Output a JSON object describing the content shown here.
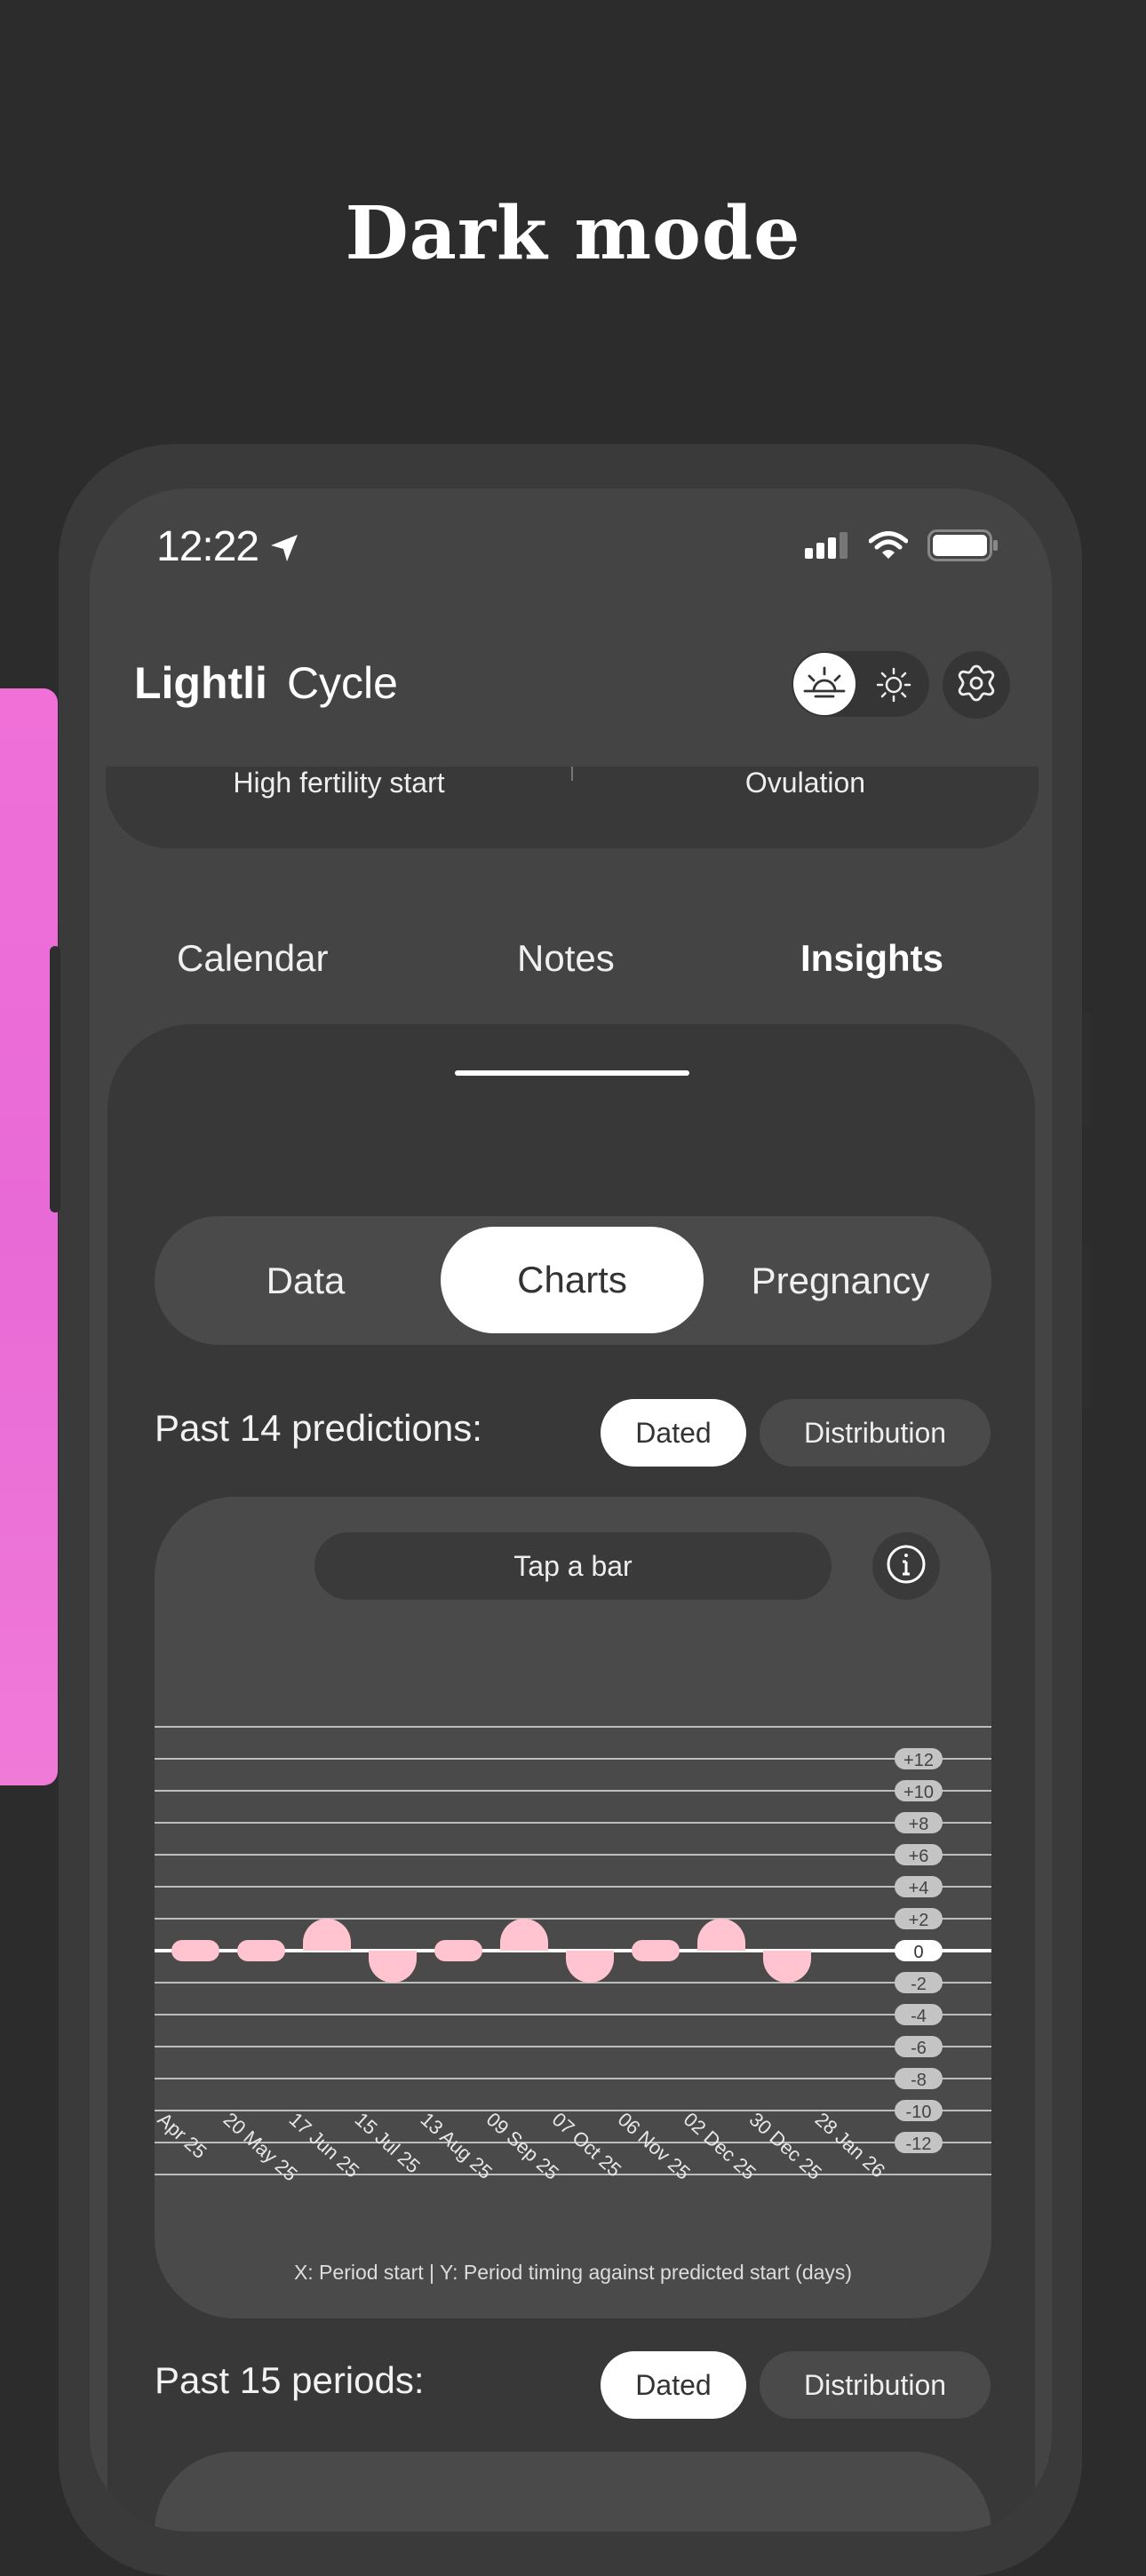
{
  "headline": "Dark mode",
  "status": {
    "time": "12:22"
  },
  "app": {
    "brand_bold": "Lightli",
    "brand_light": "Cycle"
  },
  "fertility": {
    "left": "High fertility start",
    "right": "Ovulation"
  },
  "tabs": [
    {
      "label": "Calendar"
    },
    {
      "label": "Notes"
    },
    {
      "label": "Insights",
      "active": true
    }
  ],
  "segments": {
    "data": "Data",
    "charts": "Charts",
    "pregnancy": "Pregnancy",
    "active": "Charts"
  },
  "predictions": {
    "title": "Past 14 predictions:",
    "dated": "Dated",
    "distribution": "Distribution",
    "active": "Dated",
    "tap_prompt": "Tap a bar"
  },
  "periods": {
    "title": "Past 15 periods:",
    "dated": "Dated",
    "distribution": "Distribution",
    "active": "Dated"
  },
  "colors": {
    "bar": "#ffc4cf",
    "accent": "#ffffff",
    "background": "#2c2c2c",
    "side_card": "#ee72d8"
  },
  "chart_data": {
    "type": "bar",
    "categories": [
      "Apr 25",
      "20 May 25",
      "17 Jun 25",
      "15 Jul 25",
      "13 Aug 25",
      "09 Sep 25",
      "07 Oct 25",
      "06 Nov 25",
      "02 Dec 25",
      "30 Dec 25",
      "28 Jan 26"
    ],
    "values": [
      0,
      0,
      1,
      -1,
      0,
      1,
      -1,
      0,
      1,
      -1
    ],
    "y_ticks": [
      "+12",
      "+10",
      "+8",
      "+6",
      "+4",
      "+2",
      "0",
      "-2",
      "-4",
      "-6",
      "-8",
      "-10",
      "-12"
    ],
    "ylim": [
      -14,
      14
    ],
    "caption": "X: Period start | Y: Period timing against predicted start (days)",
    "grid": true
  }
}
